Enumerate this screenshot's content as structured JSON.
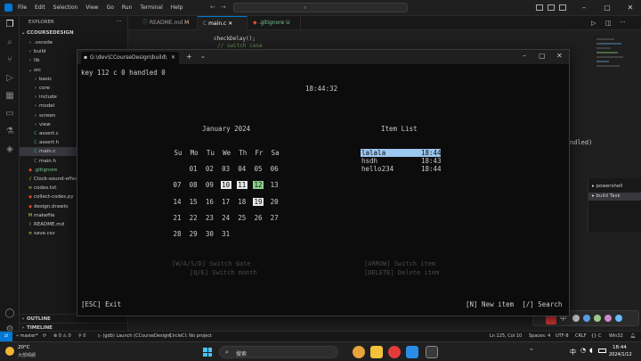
{
  "menu": [
    "File",
    "Edit",
    "Selection",
    "View",
    "Go",
    "Run",
    "Terminal",
    "Help"
  ],
  "explorer": {
    "header": "EXPLORER",
    "root": "CCOURSEDESIGN",
    "items": [
      {
        "label": ".vscode",
        "depth": 1,
        "folder": true
      },
      {
        "label": "build",
        "depth": 1,
        "folder": true
      },
      {
        "label": "lib",
        "depth": 1,
        "folder": true
      },
      {
        "label": "src",
        "depth": 1,
        "folder": true,
        "open": true
      },
      {
        "label": "basic",
        "depth": 2,
        "folder": true
      },
      {
        "label": "core",
        "depth": 2,
        "folder": true
      },
      {
        "label": "include",
        "depth": 2,
        "folder": true
      },
      {
        "label": "model",
        "depth": 2,
        "folder": true
      },
      {
        "label": "screen",
        "depth": 2,
        "folder": true
      },
      {
        "label": "view",
        "depth": 2,
        "folder": true
      },
      {
        "label": "assert.c",
        "depth": 2,
        "icon": "C"
      },
      {
        "label": "assert.h",
        "depth": 2,
        "icon": "C"
      },
      {
        "label": "main.c",
        "depth": 2,
        "icon": "C",
        "active": true
      },
      {
        "label": "main.h",
        "depth": 2,
        "icon": "C"
      },
      {
        "label": ".gitignore",
        "depth": 1,
        "icon": "◆"
      },
      {
        "label": "Clock-sound-effect...",
        "depth": 1,
        "icon": "♪"
      },
      {
        "label": "codes.txt",
        "depth": 1,
        "icon": "≡"
      },
      {
        "label": "collect-codes.py",
        "depth": 1,
        "icon": "◆"
      },
      {
        "label": "design.drawio",
        "depth": 1,
        "icon": "◆"
      },
      {
        "label": "makefile",
        "depth": 1,
        "icon": "M"
      },
      {
        "label": "README.md",
        "depth": 1,
        "icon": "i"
      },
      {
        "label": "save.csv",
        "depth": 1,
        "icon": "≡"
      }
    ],
    "outline": "OUTLINE",
    "timeline": "TIMELINE"
  },
  "tabs": [
    {
      "label": "README.md",
      "modified": "M"
    },
    {
      "label": "main.c",
      "active": true
    },
    {
      "label": ".gitignore",
      "modified": "U"
    }
  ],
  "code_snippet": [
    "checkDelay();",
    "// switch case"
  ],
  "terminal_panel": {
    "handled_text": "ndled)",
    "items": [
      "powershell",
      "build Task"
    ]
  },
  "terminal": {
    "tab_title": "G:\\dev\\CCourseDesign\\build\\",
    "status_line": "key 112 c 0 handled 0",
    "clock": "18:44:32",
    "calendar": {
      "title": "January 2024",
      "weekdays": [
        "Su",
        "Mo",
        "Tu",
        "We",
        "Th",
        "Fr",
        "Sa"
      ],
      "weeks": [
        [
          "",
          "01",
          "02",
          "03",
          "04",
          "05",
          "06"
        ],
        [
          "07",
          "08",
          "09",
          "10",
          "11",
          "12",
          "13"
        ],
        [
          "14",
          "15",
          "16",
          "17",
          "18",
          "19",
          "20"
        ],
        [
          "21",
          "22",
          "23",
          "24",
          "25",
          "26",
          "27"
        ],
        [
          "28",
          "29",
          "30",
          "31",
          "",
          "",
          ""
        ]
      ],
      "highlight_white": [
        "10",
        "11",
        "19"
      ],
      "highlight_green": [
        "12"
      ]
    },
    "item_list": {
      "title": "Item List",
      "items": [
        {
          "name": "lalala",
          "time": "18:44",
          "selected": true
        },
        {
          "name": "hsdh",
          "time": "18:43"
        },
        {
          "name": "hello234",
          "time": "18:44"
        }
      ]
    },
    "hints_left": [
      "[W/A/S/D] Switch date",
      "[Q/E] Switch month"
    ],
    "hints_right": [
      "[ARROW] Switch item",
      "[DELETE] Delete item"
    ],
    "footer_left": "[ESC] Exit",
    "footer_right": "[N] New item  [/] Search"
  },
  "statusbar": {
    "branch": "master*",
    "errors": "0",
    "warnings": "0",
    "ports": "0",
    "launch": "(gdb) Launch (CCourseDesign)",
    "circleci": "CircleCI: No project",
    "position": "Ln 125, Col 10",
    "spaces": "Spaces: 4",
    "encoding": "UTF-8",
    "eol": "CRLF",
    "lang": "C",
    "platform": "Win32"
  },
  "taskbar": {
    "weather_temp": "20°C",
    "weather_desc": "大部晴朗",
    "search_placeholder": "搜索",
    "time": "18:44",
    "date": "2024/1/12",
    "lang": "中"
  },
  "colors": {
    "accent": "#0078d4",
    "selection_bg": "#9cc8f0",
    "highlight_green": "#8bd18b"
  }
}
